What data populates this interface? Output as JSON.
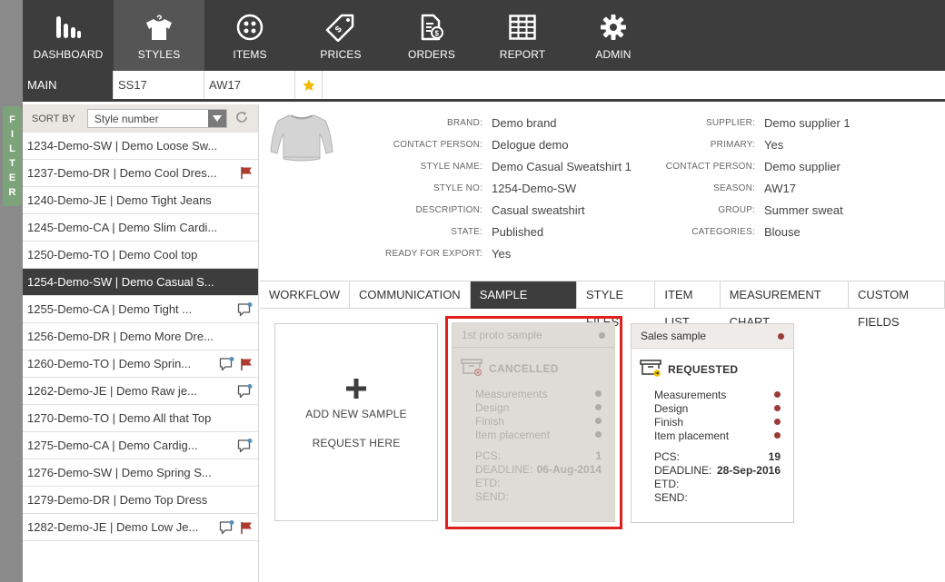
{
  "nav": [
    {
      "label": "DASHBOARD",
      "icon": "dashboard-icon",
      "active": false
    },
    {
      "label": "STYLES",
      "icon": "shirt-icon",
      "active": true
    },
    {
      "label": "ITEMS",
      "icon": "button-icon",
      "active": false
    },
    {
      "label": "PRICES",
      "icon": "price-tag-icon",
      "active": false
    },
    {
      "label": "ORDERS",
      "icon": "order-document-icon",
      "active": false
    },
    {
      "label": "REPORT",
      "icon": "table-grid-icon",
      "active": false
    },
    {
      "label": "ADMIN",
      "icon": "gear-icon",
      "active": false
    }
  ],
  "seasons": {
    "main": "MAIN",
    "s1": "SS17",
    "s2": "AW17",
    "star_color": "#f2b800"
  },
  "filter": {
    "letters": [
      "F",
      "I",
      "L",
      "T",
      "E",
      "R"
    ]
  },
  "sidebar": {
    "sort_label": "SORT BY",
    "sort_value": "Style number",
    "items": [
      {
        "text": "1234-Demo-SW | Demo Loose Sw...",
        "comment": false,
        "flag": false
      },
      {
        "text": "1237-Demo-DR | Demo Cool Dres...",
        "comment": false,
        "flag": true
      },
      {
        "text": "1240-Demo-JE | Demo Tight Jeans",
        "comment": false,
        "flag": false
      },
      {
        "text": "1245-Demo-CA | Demo Slim Cardi...",
        "comment": false,
        "flag": false
      },
      {
        "text": "1250-Demo-TO | Demo Cool top",
        "comment": false,
        "flag": false
      },
      {
        "text": "1254-Demo-SW | Demo Casual S...",
        "comment": false,
        "flag": false,
        "selected": true
      },
      {
        "text": "1255-Demo-CA | Demo Tight ...",
        "comment": true,
        "flag": false
      },
      {
        "text": "1256-Demo-DR | Demo More Dre...",
        "comment": false,
        "flag": false
      },
      {
        "text": "1260-Demo-TO | Demo Sprin...",
        "comment": true,
        "flag": true
      },
      {
        "text": "1262-Demo-JE | Demo Raw je...",
        "comment": true,
        "flag": false
      },
      {
        "text": "1270-Demo-TO | Demo All that Top",
        "comment": false,
        "flag": false
      },
      {
        "text": "1275-Demo-CA | Demo Cardig...",
        "comment": true,
        "flag": false
      },
      {
        "text": "1276-Demo-SW | Demo Spring S...",
        "comment": false,
        "flag": false
      },
      {
        "text": "1279-Demo-DR | Demo Top Dress",
        "comment": false,
        "flag": false
      },
      {
        "text": "1282-Demo-JE | Demo Low Je...",
        "comment": true,
        "flag": true
      }
    ],
    "flag_color": "#b23a2f"
  },
  "style": {
    "left": [
      {
        "label": "BRAND:",
        "value": "Demo brand"
      },
      {
        "label": "CONTACT PERSON:",
        "value": "Delogue demo"
      },
      {
        "label": "STYLE NAME:",
        "value": "Demo Casual Sweatshirt 1"
      },
      {
        "label": "STYLE NO:",
        "value": "1254-Demo-SW"
      },
      {
        "label": "DESCRIPTION:",
        "value": "Casual sweatshirt"
      },
      {
        "label": "STATE:",
        "value": "Published"
      },
      {
        "label": "READY FOR EXPORT:",
        "value": "Yes"
      }
    ],
    "right": [
      {
        "label": "SUPPLIER:",
        "value": "Demo supplier 1"
      },
      {
        "label": "PRIMARY:",
        "value": "Yes"
      },
      {
        "label": "CONTACT PERSON:",
        "value": "Demo supplier"
      },
      {
        "label": "SEASON:",
        "value": "AW17"
      },
      {
        "label": "GROUP:",
        "value": "Summer sweat"
      },
      {
        "label": "CATEGORIES:",
        "value": "Blouse"
      }
    ]
  },
  "tabs": [
    {
      "label": "WORKFLOW",
      "active": false
    },
    {
      "label": "COMMUNICATION",
      "active": false
    },
    {
      "label": "SAMPLE REQUEST",
      "active": true
    },
    {
      "label": "STYLE FILES",
      "active": false
    },
    {
      "label": "ITEM LIST",
      "active": false
    },
    {
      "label": "MEASUREMENT CHART",
      "active": false
    },
    {
      "label": "CUSTOM FIELDS",
      "active": false
    }
  ],
  "add_card": {
    "line1": "ADD NEW SAMPLE",
    "line2": "REQUEST HERE"
  },
  "samples": [
    {
      "title": "1st proto sample",
      "status": "CANCELLED",
      "steps": [
        "Measurements",
        "Design",
        "Finish",
        "Item placement"
      ],
      "pcs_label": "PCS:",
      "pcs": "1",
      "deadline_label": "DEADLINE:",
      "deadline": "06-Aug-2014",
      "etd_label": "ETD:",
      "etd": "",
      "send_label": "SEND:",
      "send": ""
    },
    {
      "title": "Sales sample",
      "status": "REQUESTED",
      "steps": [
        "Measurements",
        "Design",
        "Finish",
        "Item placement"
      ],
      "pcs_label": "PCS:",
      "pcs": "19",
      "deadline_label": "DEADLINE:",
      "deadline": "28-Sep-2016",
      "etd_label": "ETD:",
      "etd": "",
      "send_label": "SEND:",
      "send": ""
    }
  ]
}
